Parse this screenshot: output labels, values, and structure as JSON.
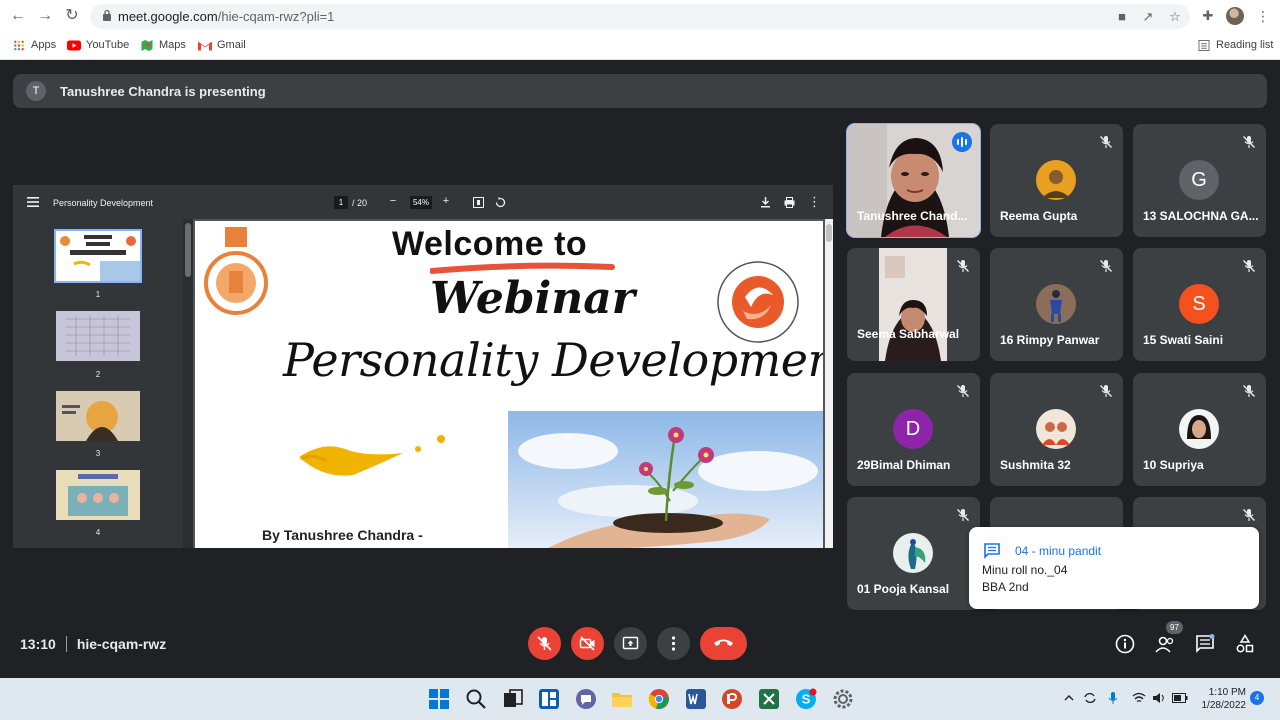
{
  "browser": {
    "url_host": "meet.google.com",
    "url_path": "/hie-cqam-rwz?pli=1",
    "bookmarks": [
      "Apps",
      "YouTube",
      "Maps",
      "Gmail"
    ],
    "reading_list": "Reading list"
  },
  "meet": {
    "presenter_initial": "T",
    "presenting_text": "Tanushree Chandra is presenting",
    "time": "13:10",
    "meeting_code": "hie-cqam-rwz",
    "people_count": "97"
  },
  "pdf": {
    "title": "Personality Development",
    "current_page": "1",
    "total_pages": "/ 20",
    "zoom": "54%",
    "thumb_numbers": [
      "1",
      "2",
      "3",
      "4"
    ],
    "slide_title": "Welcome to",
    "slide_webinar": "Webinar",
    "slide_subtitle": "Personality Development",
    "slide_by": "By Tanushree Chandra -"
  },
  "participants": [
    {
      "name": "Tanushree Chand...",
      "initial": ""
    },
    {
      "name": "Reema Gupta",
      "initial": ""
    },
    {
      "name": "13 SALOCHNA GA...",
      "initial": "G"
    },
    {
      "name": "Seema Sabharwal",
      "initial": ""
    },
    {
      "name": "16 Rimpy Panwar",
      "initial": ""
    },
    {
      "name": "15 Swati Saini",
      "initial": "S"
    },
    {
      "name": "29Bimal Dhiman",
      "initial": "D"
    },
    {
      "name": "Sushmita 32",
      "initial": ""
    },
    {
      "name": "10 Supriya",
      "initial": ""
    },
    {
      "name": "01 Pooja Kansal",
      "initial": ""
    }
  ],
  "chat": {
    "sender": "04 - minu pandit",
    "line1": "Minu roll no._04",
    "line2": "BBA 2nd"
  },
  "taskbar": {
    "clock_time": "1:10 PM",
    "clock_date": "1/28/2022",
    "notification_count": "4"
  },
  "colors": {
    "meet_bg": "#202124",
    "tile_bg": "#3c4043",
    "red": "#ea4335",
    "accent_blue": "#8ab4f8",
    "chat_blue": "#1a73e8"
  }
}
